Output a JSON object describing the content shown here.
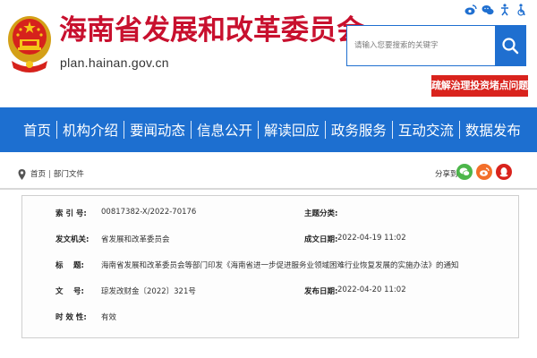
{
  "header": {
    "title": "海南省发展和改革委员会",
    "url": "plan.hainan.gov.cn",
    "search_placeholder": "请输入您要搜索的关键字",
    "promo": "疏解治理投资堵点问题"
  },
  "top_icons": [
    "weibo-icon",
    "wechat-icon",
    "accessibility-icon",
    "elderly-care-icon"
  ],
  "nav": {
    "items": [
      "首页",
      "机构介绍",
      "要闻动态",
      "信息公开",
      "解读回应",
      "政务服务",
      "互动交流",
      "数据发布"
    ]
  },
  "breadcrumb": {
    "items": [
      "首页",
      "部门文件"
    ],
    "separator": "|",
    "share_label": "分享到:"
  },
  "info": {
    "index_label": "索 引 号:",
    "index_value": "00817382-X/2022-70176",
    "subject_label": "主题分类:",
    "subject_value": "",
    "issuer_label": "发文机关:",
    "issuer_value": "省发展和改革委员会",
    "created_label": "成文日期:",
    "created_value": "2022-04-19 11:02",
    "title_label": "标　 题:",
    "title_value": "海南省发展和改革委员会等部门印发《海南省进一步促进服务业领域困难行业恢复发展的实施办法》的通知",
    "docno_label": "文　 号:",
    "docno_value": "琼发改财金〔2022〕321号",
    "published_label": "发布日期:",
    "published_value": "2022-04-20 11:02",
    "validity_label": "时 效 性:",
    "validity_value": "有效"
  },
  "colors": {
    "brand_red": "#c8102e",
    "nav_blue": "#1d6fd0",
    "promo_red": "#d9231d"
  }
}
